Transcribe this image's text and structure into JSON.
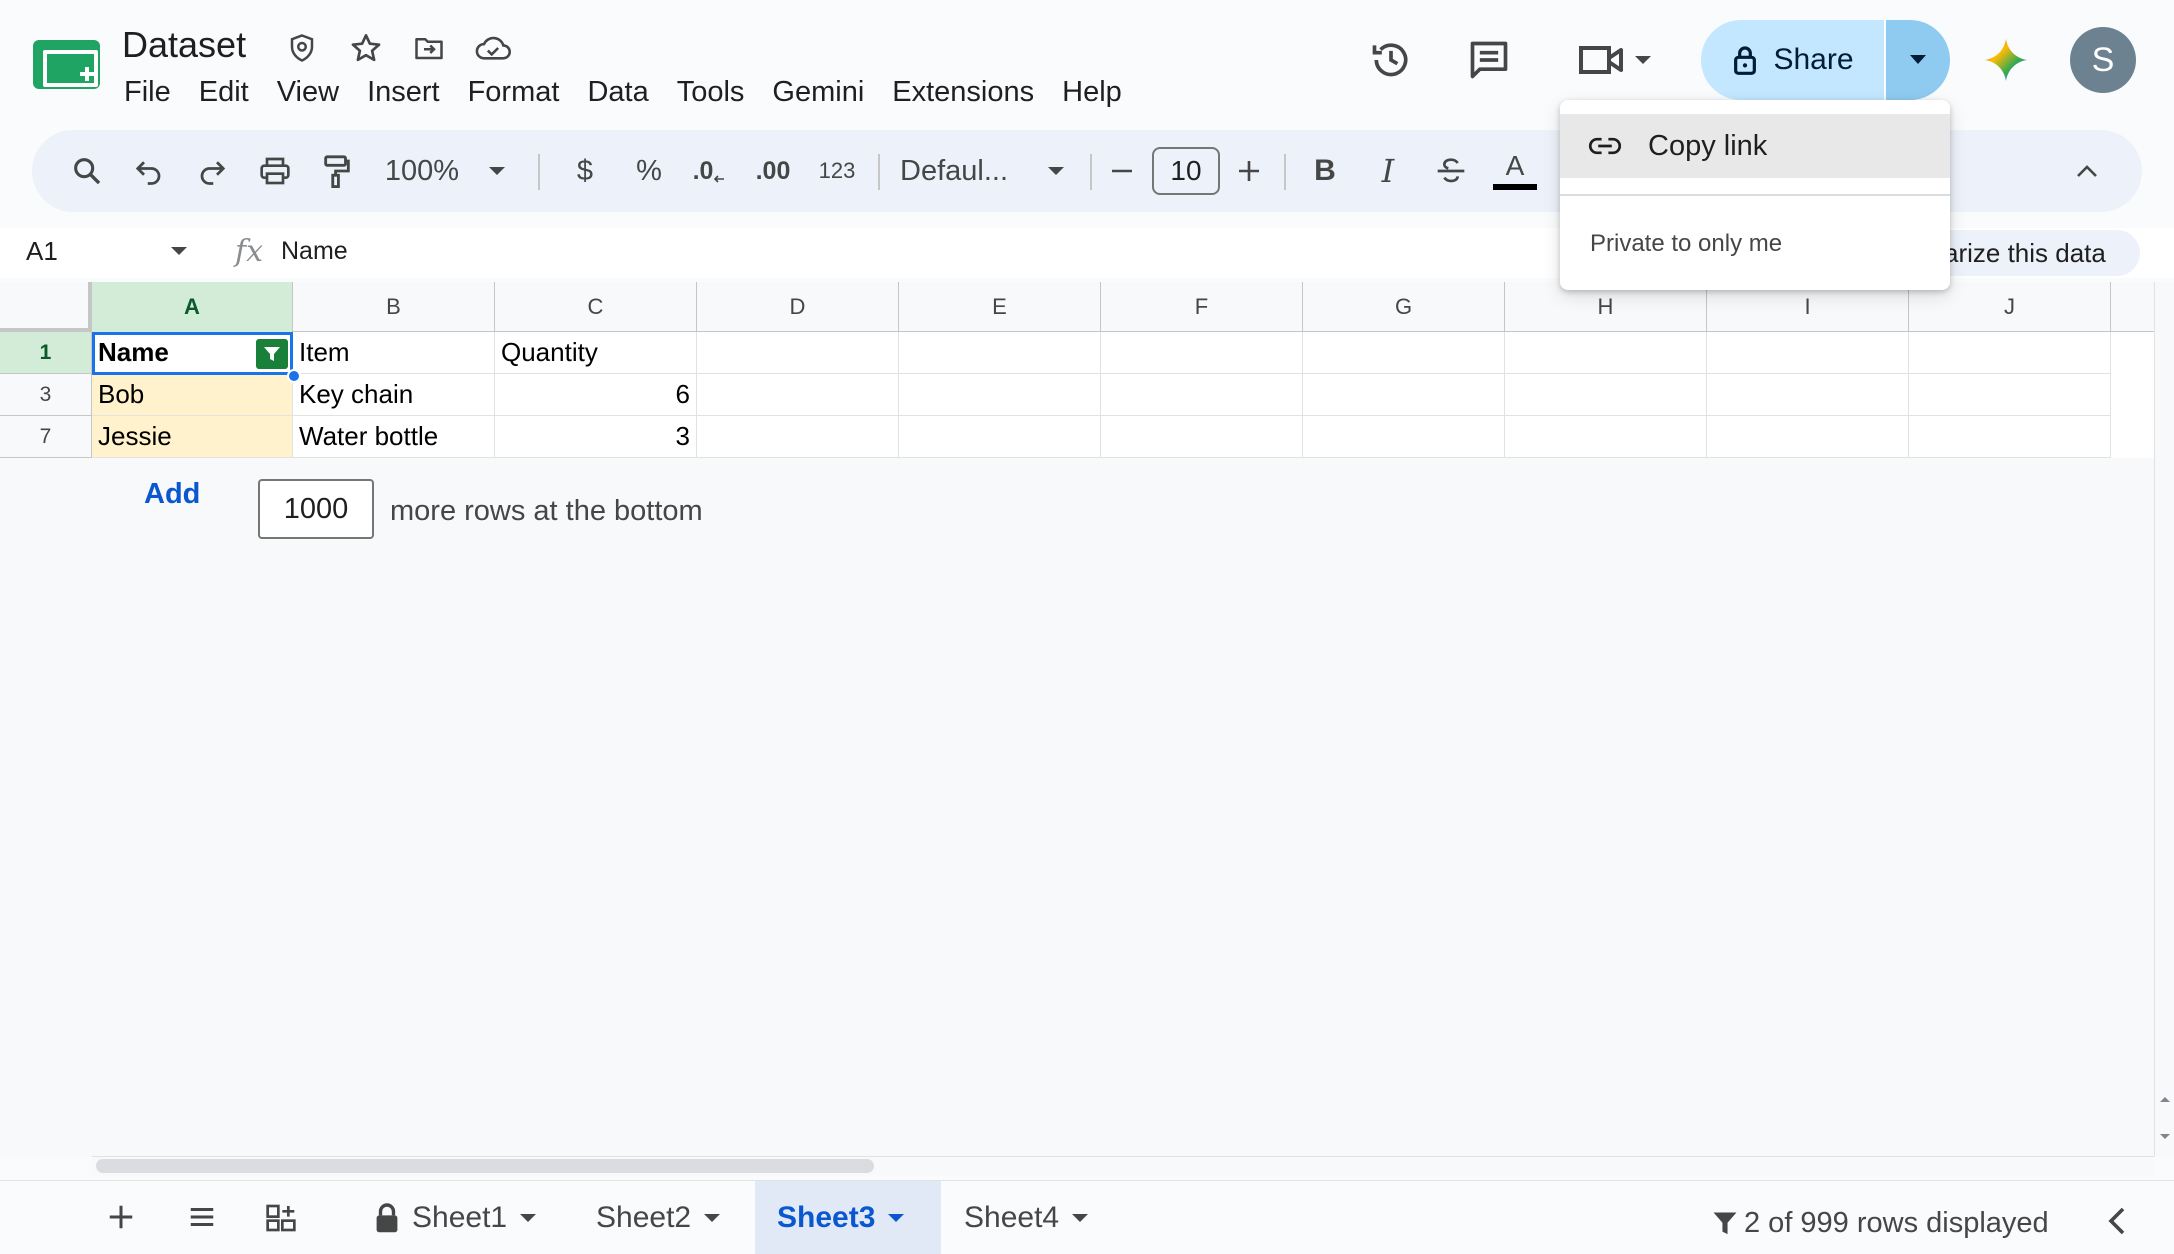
{
  "app": {
    "title": "Dataset",
    "brand_color": "#1fa463",
    "title_icons": [
      "shield-icon",
      "star-icon",
      "move-folder-icon",
      "cloud-saved-icon"
    ]
  },
  "menu": [
    "File",
    "Edit",
    "View",
    "Insert",
    "Format",
    "Data",
    "Tools",
    "Gemini",
    "Extensions",
    "Help"
  ],
  "header": {
    "icons": [
      "history-icon",
      "comments-icon",
      "meet-icon",
      "gemini-icon"
    ],
    "share_label": "Share",
    "avatar_initial": "S"
  },
  "toolbar": {
    "zoom": "100%",
    "currency": "$",
    "percent": "%",
    "decrease_decimal": ".0",
    "increase_decimal": ".00",
    "number_format": "123",
    "font": "Defaul...",
    "font_size": "10",
    "bold": "B",
    "italic": "I",
    "text_color": "A"
  },
  "formula_bar": {
    "name_box": "A1",
    "fx": "fx",
    "content": "Name",
    "summarize_chip": "arize this data"
  },
  "grid": {
    "columns": [
      "A",
      "B",
      "C",
      "D",
      "E",
      "F",
      "G",
      "H",
      "I",
      "J"
    ],
    "selected_column": "A",
    "rows": [
      {
        "row_number": "1",
        "cells": [
          "Name",
          "Item",
          "Quantity"
        ]
      },
      {
        "row_number": "3",
        "cells": [
          "Bob",
          "Key chain",
          "6"
        ]
      },
      {
        "row_number": "7",
        "cells": [
          "Jessie",
          "Water bottle",
          "3"
        ]
      }
    ],
    "highlight_color": "#fff2cc",
    "add_rows": {
      "button": "Add",
      "count": "1000",
      "suffix": "more rows at the bottom"
    }
  },
  "dropdown": {
    "copy_link": "Copy link",
    "access_note": "Private to only me"
  },
  "sheets": [
    {
      "name": "Sheet1",
      "locked": true,
      "active": false
    },
    {
      "name": "Sheet2",
      "locked": false,
      "active": false
    },
    {
      "name": "Sheet3",
      "locked": false,
      "active": true
    },
    {
      "name": "Sheet4",
      "locked": false,
      "active": false
    }
  ],
  "status": {
    "rows_displayed": "2 of 999 rows displayed"
  }
}
